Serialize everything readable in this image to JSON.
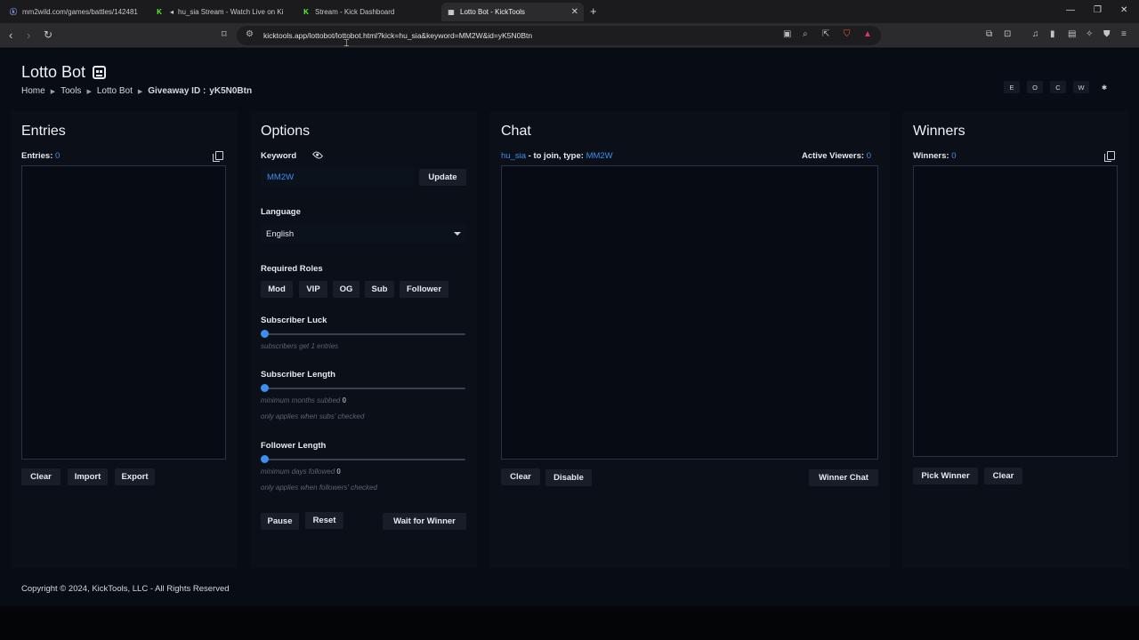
{
  "browser": {
    "tabs": [
      {
        "title": "mm2wild.com/games/battles/142481",
        "icon": "mm2wild-icon",
        "color": "#5a7bd6"
      },
      {
        "title": "hu_sia Stream - Watch Live on Ki",
        "icon": "kick-icon",
        "color": "#53fc18"
      },
      {
        "title": "Stream - Kick Dashboard",
        "icon": "kick-icon",
        "color": "#53fc18"
      },
      {
        "title": "Lotto Bot - KickTools",
        "icon": "kicktools-icon",
        "color": "#ffffff"
      }
    ],
    "url": "kicktools.app/lottobot/lottobot.html?kick=hu_sia&keyword=MM2W&id=yK5N0Btn"
  },
  "page": {
    "title": "Lotto Bot",
    "breadcrumb": {
      "home": "Home",
      "tools": "Tools",
      "lotto": "Lotto Bot",
      "giveaway_label": "Giveaway ID :",
      "giveaway_id": "yK5N0Btn"
    },
    "theme_buttons": [
      "E",
      "O",
      "C",
      "W",
      "✱"
    ]
  },
  "entries": {
    "heading": "Entries",
    "count_label": "Entries:",
    "count": "0",
    "buttons": {
      "clear": "Clear",
      "import": "Import",
      "export": "Export"
    }
  },
  "options": {
    "heading": "Options",
    "keyword_label": "Keyword",
    "keyword_value": "MM2W",
    "update": "Update",
    "language_label": "Language",
    "language_value": "English",
    "roles_label": "Required Roles",
    "roles": [
      "Mod",
      "VIP",
      "OG",
      "Sub",
      "Follower"
    ],
    "sub_luck_label": "Subscriber Luck",
    "sub_luck_hint": "subscribers get 1 entries",
    "sub_luck_value": 1,
    "sub_length_label": "Subscriber Length",
    "sub_length_hint": "minimum months subbed",
    "sub_length_value": "0",
    "sub_length_note": "only applies when subs' checked",
    "follower_length_label": "Follower Length",
    "follower_length_hint": "minimum days followed",
    "follower_length_value": "0",
    "follower_length_note": "only applies when followers' checked",
    "buttons": {
      "pause": "Pause",
      "reset": "Reset",
      "wait": "Wait for Winner"
    }
  },
  "chat": {
    "heading": "Chat",
    "channel": "hu_sia",
    "join_text": "- to join, type:",
    "keyword": "MM2W",
    "viewers_label": "Active Viewers:",
    "viewers": "0",
    "buttons": {
      "clear": "Clear",
      "disable": "Disable",
      "winner_chat": "Winner Chat"
    }
  },
  "winners": {
    "heading": "Winners",
    "count_label": "Winners:",
    "count": "0",
    "buttons": {
      "pick": "Pick Winner",
      "clear": "Clear"
    }
  },
  "footer": {
    "text": "Copyright © 2024, KickTools, LLC - All Rights Reserved"
  },
  "colors": {
    "accent": "#3b8ff0",
    "background": "#070c15",
    "panel": "#0a0f18"
  }
}
